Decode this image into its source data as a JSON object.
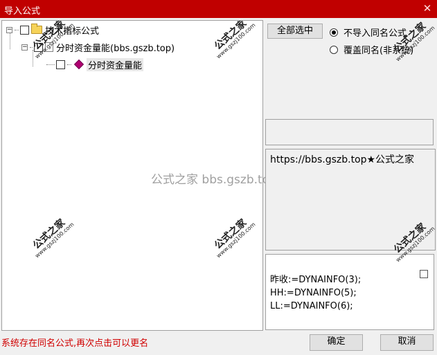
{
  "window": {
    "title": "导入公式",
    "close_glyph": "✕"
  },
  "tree": {
    "root_label": "技术指标公式",
    "child_label": "分时资金量能(bbs.gszb.top)",
    "grandchild_label": "分时资金量能"
  },
  "options": {
    "select_all_label": "全部选中",
    "radio_skip_label": "不导入同名公式",
    "radio_overwrite_label": "覆盖同名(非系统)",
    "selected_radio": "skip"
  },
  "description": {
    "text": "https://bbs.gszb.top★公式之家"
  },
  "code": {
    "lines": [
      "昨收:=DYNAINFO(3);",
      "HH:=DYNAINFO(5);",
      "LL:=DYNAINFO(6);"
    ]
  },
  "watermark": {
    "center_text": "公式之家 bbs.gszb.top",
    "big": "公式之家",
    "small": "www.gszj100.com"
  },
  "status": {
    "message": "系统存在同名公式,再次点击可以更名"
  },
  "buttons": {
    "ok_label": "确定",
    "cancel_label": "取消"
  }
}
